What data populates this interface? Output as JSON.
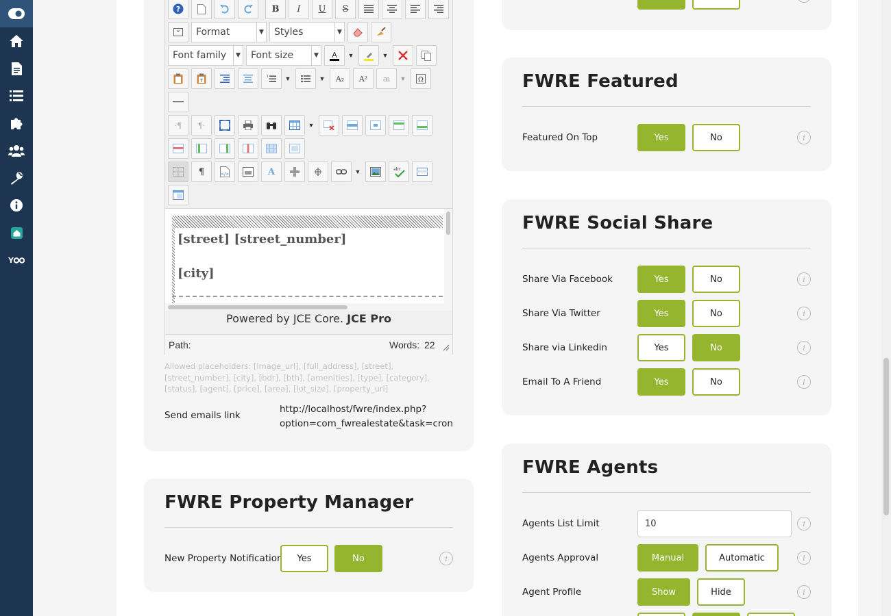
{
  "sidebar": {
    "items": [
      "toggle-icon",
      "home-icon",
      "document-icon",
      "list-icon",
      "puzzle-icon",
      "users-icon",
      "wrench-icon",
      "info-icon",
      "fwre-logo-icon",
      "yoo-logo"
    ]
  },
  "editor": {
    "format_select": "Format",
    "styles_select": "Styles",
    "font_family_select": "Font family",
    "font_size_select": "Font size",
    "content_line1": "[street] [street_number]",
    "content_line2": "[city]",
    "powered_prefix": "Powered by JCE Core.",
    "powered_brand": "JCE Pro",
    "path_label": "Path:",
    "words_label": "Words:",
    "words_count": "22"
  },
  "placeholders_text": "Allowed placeholders: [image_url], [full_address], [street], [street_number], [city], [bdr], [bth], [amenities], [type], [category], [status], [agent], [price], [area], [lot_size], [property_url]",
  "send_emails": {
    "label": "Send emails link",
    "url_line1": "http://localhost/fwre/index.php?",
    "url_line2": "option=com_fwrealestate&task=cron"
  },
  "property_manager": {
    "title": "FWRE Property Manager",
    "notification_label": "New Property Notification",
    "yes": "Yes",
    "no": "No"
  },
  "featured": {
    "title": "FWRE Featured",
    "featured_on_top_label": "Featured On Top",
    "yes": "Yes",
    "no": "No"
  },
  "social_share": {
    "title": "FWRE Social Share",
    "rows": [
      {
        "label": "Share Via Facebook",
        "yes": "Yes",
        "no": "No",
        "selected": "Yes"
      },
      {
        "label": "Share Via Twitter",
        "yes": "Yes",
        "no": "No",
        "selected": "Yes"
      },
      {
        "label": "Share via Linkedin",
        "yes": "Yes",
        "no": "No",
        "selected": "No"
      },
      {
        "label": "Email To A Friend",
        "yes": "Yes",
        "no": "No",
        "selected": "Yes"
      }
    ]
  },
  "agents": {
    "title": "FWRE Agents",
    "list_limit_label": "Agents List Limit",
    "list_limit_value": "10",
    "approval_label": "Agents Approval",
    "approval_manual": "Manual",
    "approval_automatic": "Automatic",
    "profile_label": "Agent Profile",
    "profile_show": "Show",
    "profile_hide": "Hide"
  },
  "colors": {
    "accent": "#95b52f",
    "sidebar": "#1e3552"
  }
}
